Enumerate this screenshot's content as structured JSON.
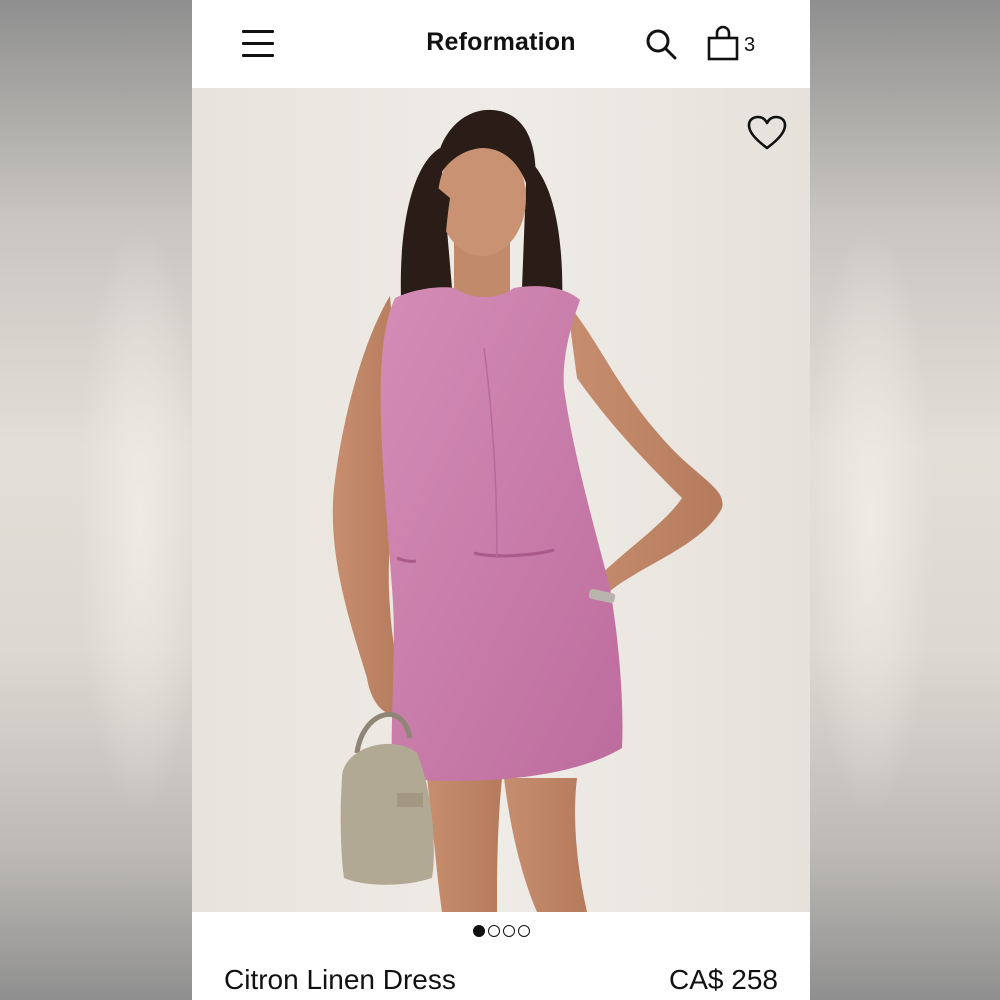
{
  "header": {
    "brand": "Reformation",
    "menu_icon": "hamburger-menu-icon",
    "search_icon": "search-icon",
    "bag_icon": "shopping-bag-icon",
    "bag_count": "3"
  },
  "gallery": {
    "favorite_icon": "heart-outline-icon",
    "image_subject": "model-in-pink-sleeveless-mini-dress",
    "slide_count": 4,
    "active_slide": 1
  },
  "product": {
    "name": "Citron Linen Dress",
    "price": "CA$ 258"
  },
  "colors": {
    "dress": "#c97aa8",
    "photo_background": "#ebe6e0",
    "text": "#111111"
  }
}
